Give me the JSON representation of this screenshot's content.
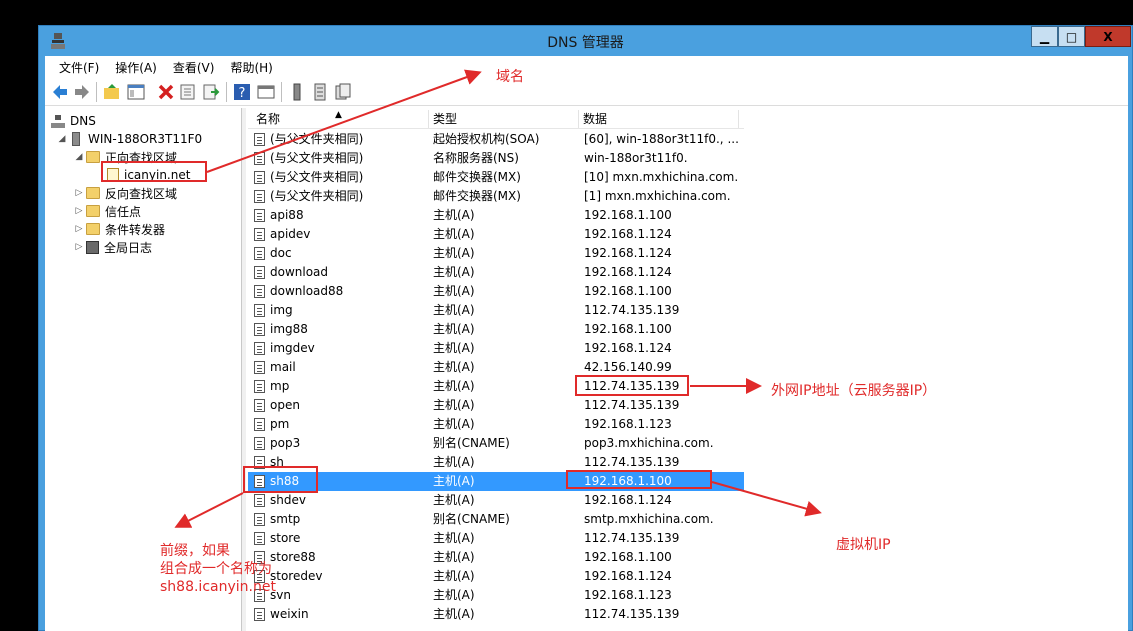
{
  "window": {
    "title": "DNS 管理器",
    "controls": {
      "minimize": "▁",
      "maximize": "□",
      "close": "X"
    }
  },
  "menu": [
    "文件(F)",
    "操作(A)",
    "查看(V)",
    "帮助(H)"
  ],
  "toolbar_icons": [
    "back-icon",
    "forward-icon",
    "up-folder-icon",
    "show-tree-icon",
    "delete-icon",
    "properties-icon",
    "export-icon",
    "help-icon",
    "console-icon",
    "server-icon",
    "list-icon",
    "records-icon"
  ],
  "tree": {
    "root": "DNS",
    "server": "WIN-188OR3T11F0",
    "forward_zone": "正向查找区域",
    "selected_zone": "icanyin.net",
    "reverse_zone": "反向查找区域",
    "trust_points": "信任点",
    "conditional_forwarders": "条件转发器",
    "global_logs": "全局日志"
  },
  "list": {
    "headers": [
      "名称",
      "类型",
      "数据"
    ],
    "rows": [
      {
        "name": "(与父文件夹相同)",
        "type": "起始授权机构(SOA)",
        "data": "[60], win-188or3t11f0., ..."
      },
      {
        "name": "(与父文件夹相同)",
        "type": "名称服务器(NS)",
        "data": "win-188or3t11f0."
      },
      {
        "name": "(与父文件夹相同)",
        "type": "邮件交换器(MX)",
        "data": "[10]  mxn.mxhichina.com."
      },
      {
        "name": "(与父文件夹相同)",
        "type": "邮件交换器(MX)",
        "data": "[1]  mxn.mxhichina.com."
      },
      {
        "name": "api88",
        "type": "主机(A)",
        "data": "192.168.1.100"
      },
      {
        "name": "apidev",
        "type": "主机(A)",
        "data": "192.168.1.124"
      },
      {
        "name": "doc",
        "type": "主机(A)",
        "data": "192.168.1.124"
      },
      {
        "name": "download",
        "type": "主机(A)",
        "data": "192.168.1.124"
      },
      {
        "name": "download88",
        "type": "主机(A)",
        "data": "192.168.1.100"
      },
      {
        "name": "img",
        "type": "主机(A)",
        "data": "112.74.135.139"
      },
      {
        "name": "img88",
        "type": "主机(A)",
        "data": "192.168.1.100"
      },
      {
        "name": "imgdev",
        "type": "主机(A)",
        "data": "192.168.1.124"
      },
      {
        "name": "mail",
        "type": "主机(A)",
        "data": "42.156.140.99"
      },
      {
        "name": "mp",
        "type": "主机(A)",
        "data": "112.74.135.139"
      },
      {
        "name": "open",
        "type": "主机(A)",
        "data": "112.74.135.139"
      },
      {
        "name": "pm",
        "type": "主机(A)",
        "data": "192.168.1.123"
      },
      {
        "name": "pop3",
        "type": "别名(CNAME)",
        "data": "pop3.mxhichina.com."
      },
      {
        "name": "sh",
        "type": "主机(A)",
        "data": "112.74.135.139"
      },
      {
        "name": "sh88",
        "type": "主机(A)",
        "data": "192.168.1.100",
        "selected": true
      },
      {
        "name": "shdev",
        "type": "主机(A)",
        "data": "192.168.1.124"
      },
      {
        "name": "smtp",
        "type": "别名(CNAME)",
        "data": "smtp.mxhichina.com."
      },
      {
        "name": "store",
        "type": "主机(A)",
        "data": "112.74.135.139"
      },
      {
        "name": "store88",
        "type": "主机(A)",
        "data": "192.168.1.100"
      },
      {
        "name": "storedev",
        "type": "主机(A)",
        "data": "192.168.1.124"
      },
      {
        "name": "svn",
        "type": "主机(A)",
        "data": "192.168.1.123"
      },
      {
        "name": "weixin",
        "type": "主机(A)",
        "data": "112.74.135.139"
      }
    ]
  },
  "annotations": {
    "domain": "域名",
    "public_ip": "外网IP地址（云服务器IP）",
    "vm_ip": "虚拟机IP",
    "prefix_line1": "前缀，如果",
    "prefix_line2": "组合成一个名称为",
    "prefix_line3": "sh88.icanyin.net"
  },
  "colors": {
    "annotation": "#e02a2a",
    "selection": "#3399ff",
    "titlebar": "#4aa0df"
  }
}
